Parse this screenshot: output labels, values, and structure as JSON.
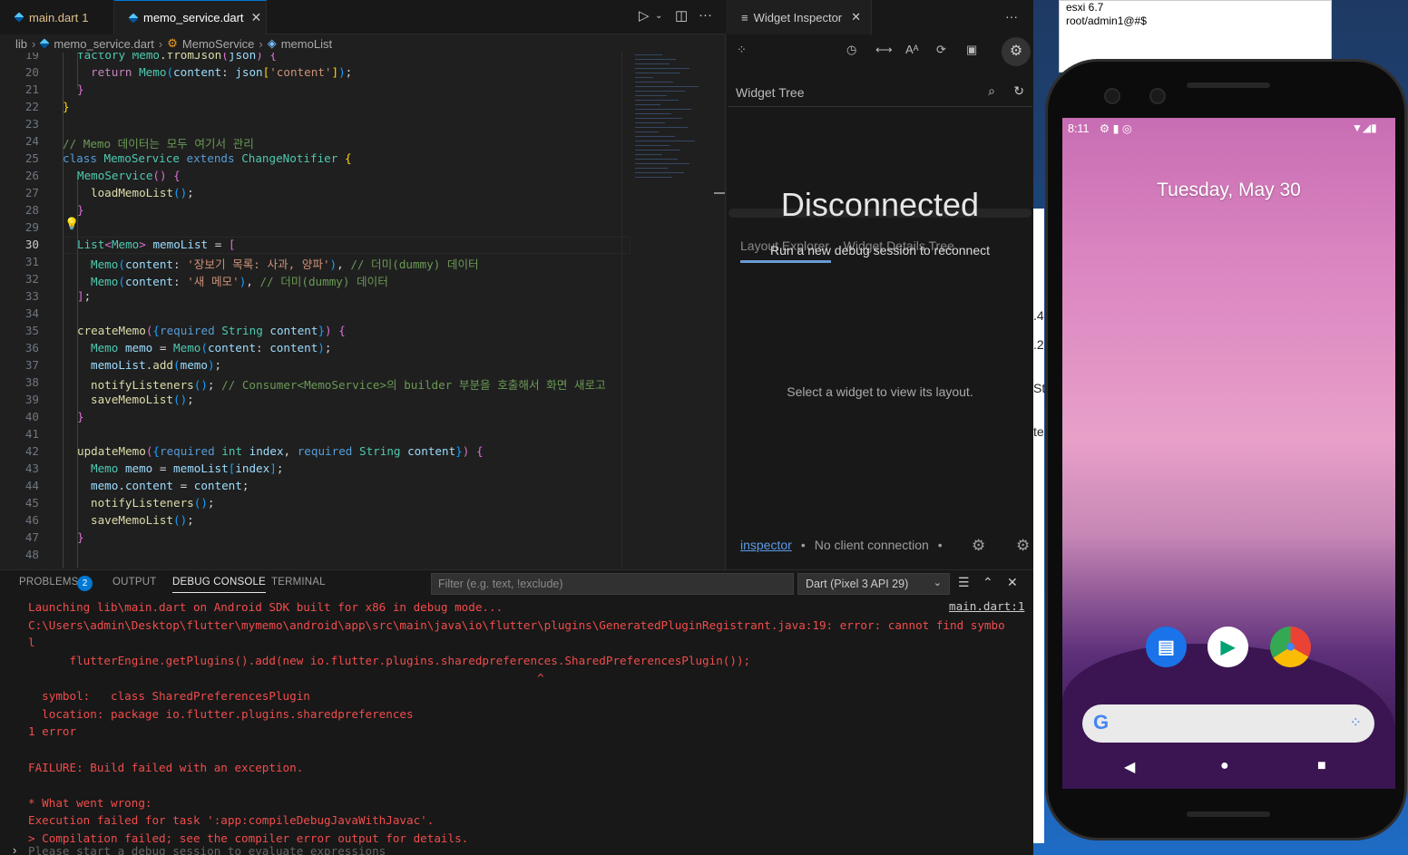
{
  "editor": {
    "tabs": [
      {
        "label": "main.dart",
        "badge": "1"
      },
      {
        "label": "memo_service.dart",
        "close": "✕"
      }
    ],
    "breadcrumb": [
      "lib",
      "memo_service.dart",
      "MemoService",
      "memoList"
    ],
    "current_line": "30"
  },
  "inspector": {
    "tab_label": "Widget Inspector",
    "tree_title": "Widget Tree",
    "status": "Disconnected",
    "layout_tabs": "Layout Explorer    Widget Details Tree",
    "reconnect_msg": "Run a new debug session to reconnect",
    "select_msg": "Select a widget to view its layout.",
    "footer_link": "inspector",
    "footer_status": "No client connection"
  },
  "panel": {
    "tabs": [
      "PROBLEMS",
      "OUTPUT",
      "DEBUG CONSOLE",
      "TERMINAL"
    ],
    "problems_count": "2",
    "filter_placeholder": "Filter (e.g. text, !exclude)",
    "device_select": "Dart (Pixel 3 API 29)",
    "source_link": "main.dart:1",
    "console": [
      "Launching lib\\main.dart on Android SDK built for x86 in debug mode...",
      "C:\\Users\\admin\\Desktop\\flutter\\mymemo\\android\\app\\src\\main\\java\\io\\flutter\\plugins\\GeneratedPluginRegistrant.java:19: error: cannot find symbo",
      "l",
      "      flutterEngine.getPlugins().add(new io.flutter.plugins.sharedpreferences.SharedPreferencesPlugin());",
      "                                                                          ^",
      "  symbol:   class SharedPreferencesPlugin",
      "  location: package io.flutter.plugins.sharedpreferences",
      "1 error",
      "",
      "FAILURE: Build failed with an exception.",
      "",
      "* What went wrong:",
      "Execution failed for task ':app:compileDebugJavaWithJavac'.",
      "> Compilation failed; see the compiler error output for details."
    ],
    "prompt": "Please start a debug session to evaluate expressions"
  },
  "desktop": {
    "note_lines": [
      "esxi 6.7",
      "root/admin1@#$"
    ],
    "edge_texts": [
      ".4",
      ".2",
      "St",
      "te"
    ]
  },
  "phone": {
    "time": "8:11",
    "status_icons": "⚙ ▮ ◎",
    "date": "Tuesday, May 30",
    "apps": [
      "messages",
      "play-store",
      "chrome"
    ]
  },
  "colors": {
    "accent": "#0078d4",
    "error": "#f14c4c",
    "link": "#5a9be6"
  }
}
